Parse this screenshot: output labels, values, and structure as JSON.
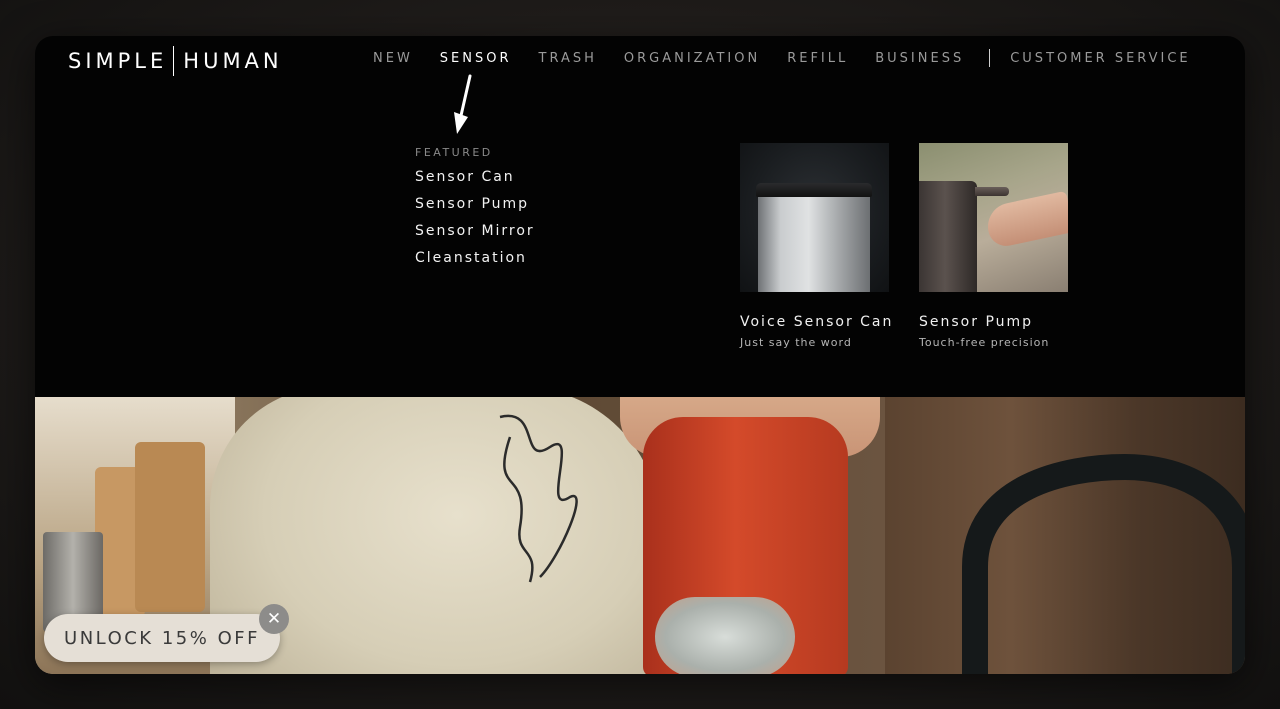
{
  "brand": {
    "logo_left": "SIMPLE",
    "logo_right": "HUMAN"
  },
  "nav": {
    "items": [
      "NEW",
      "SENSOR",
      "TRASH",
      "ORGANIZATION",
      "REFILL",
      "BUSINESS"
    ],
    "active": "SENSOR",
    "service": "CUSTOMER SERVICE"
  },
  "menu": {
    "featured_label": "FEATURED",
    "links": [
      "Sensor Can",
      "Sensor Pump",
      "Sensor Mirror",
      "Cleanstation"
    ]
  },
  "cards": [
    {
      "title": "Voice Sensor Can",
      "subtitle": "Just say the word"
    },
    {
      "title": "Sensor Pump",
      "subtitle": "Touch-free precision"
    }
  ],
  "promo": {
    "label": "UNLOCK 15% OFF",
    "close_glyph": "✕"
  },
  "colors": {
    "background": "#030303",
    "active_nav": "#ffffff",
    "inactive_nav": "#9a9a9a",
    "promo_bg": "#e5dfd6"
  }
}
